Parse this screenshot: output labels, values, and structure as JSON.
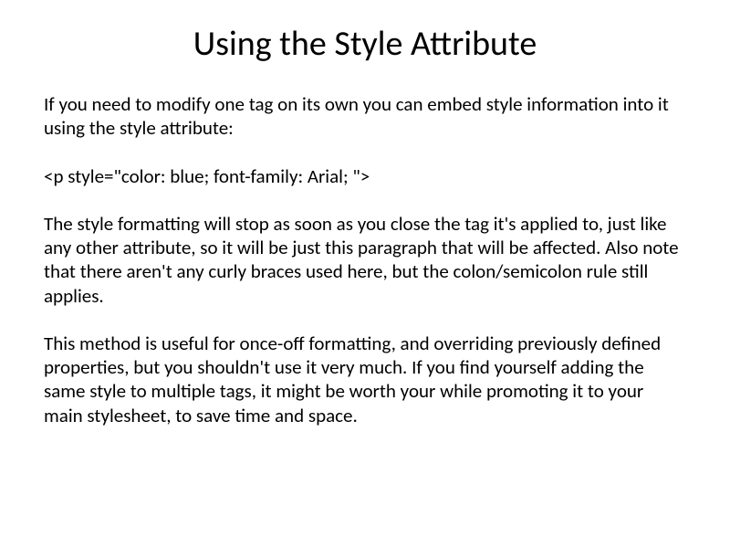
{
  "title": "Using the Style Attribute",
  "para1": "If you need to modify one tag on its own you can embed style information into it using the style attribute:",
  "code": "<p style=\"color: blue; font-family: Arial; \">",
  "para2": "The style formatting will stop as soon as you close the tag it's applied to, just like any other attribute, so it will be just this paragraph that will be affected. Also note that there aren't any curly braces used here, but the colon/semicolon rule still applies.",
  "para3": "This method is useful for once-off formatting, and overriding previously defined properties, but you shouldn't use it very much. If you find yourself adding the same style to multiple tags, it might be worth your while promoting it to your main stylesheet, to save time and space."
}
